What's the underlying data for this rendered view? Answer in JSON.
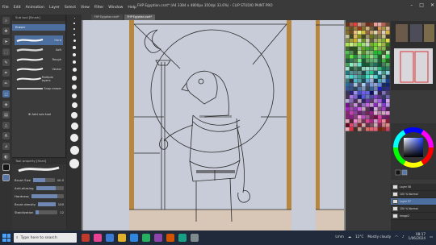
{
  "window": {
    "title": "FHP Egyptian.csnt* (A4 3384 x 4800px 350dpi 33.6%) - CLIP STUDIO PAINT PRO",
    "menu": [
      "File",
      "Edit",
      "Animation",
      "Layer",
      "Select",
      "View",
      "Filter",
      "Window",
      "Help"
    ]
  },
  "doc_tabs": [
    "FHP Egyptian.csnt*",
    "FHP Egyptian.csnt*"
  ],
  "subtool": {
    "header": "Sub tool [Brush]",
    "active_group": "Eraser",
    "brushes": [
      {
        "label": "Hard"
      },
      {
        "label": "Soft"
      },
      {
        "label": "Rough"
      },
      {
        "label": "Vector"
      },
      {
        "label": "Multiple layers"
      },
      {
        "label": "Snap eraser"
      }
    ],
    "add_label": "Add sub tool"
  },
  "tool_property": {
    "header": "Tool property [Hard]",
    "rows": [
      {
        "label": "Brush Size",
        "value": "40.0"
      },
      {
        "label": "Anti-aliasing",
        "value": ""
      },
      {
        "label": "Hardness",
        "value": ""
      },
      {
        "label": "Brush density",
        "value": "100"
      },
      {
        "label": "Stabilization",
        "value": "12"
      }
    ]
  },
  "taskbar": {
    "search_placeholder": "Type here to search",
    "weather_temp": "12°C",
    "weather_desc": "Mostly cloudy",
    "language": "Lmm",
    "time": "08:17",
    "date": "1/06/2024"
  },
  "layers": {
    "items": [
      "Layer 58",
      "100 % Normal",
      "Layer 57",
      "100 % Normal",
      "Image2"
    ]
  },
  "colors": {
    "accent": "#4c6f9f",
    "canvas_bg": "#c8ccd8",
    "frame_wood": "#b8873f",
    "floor": "#d8c6b6"
  }
}
